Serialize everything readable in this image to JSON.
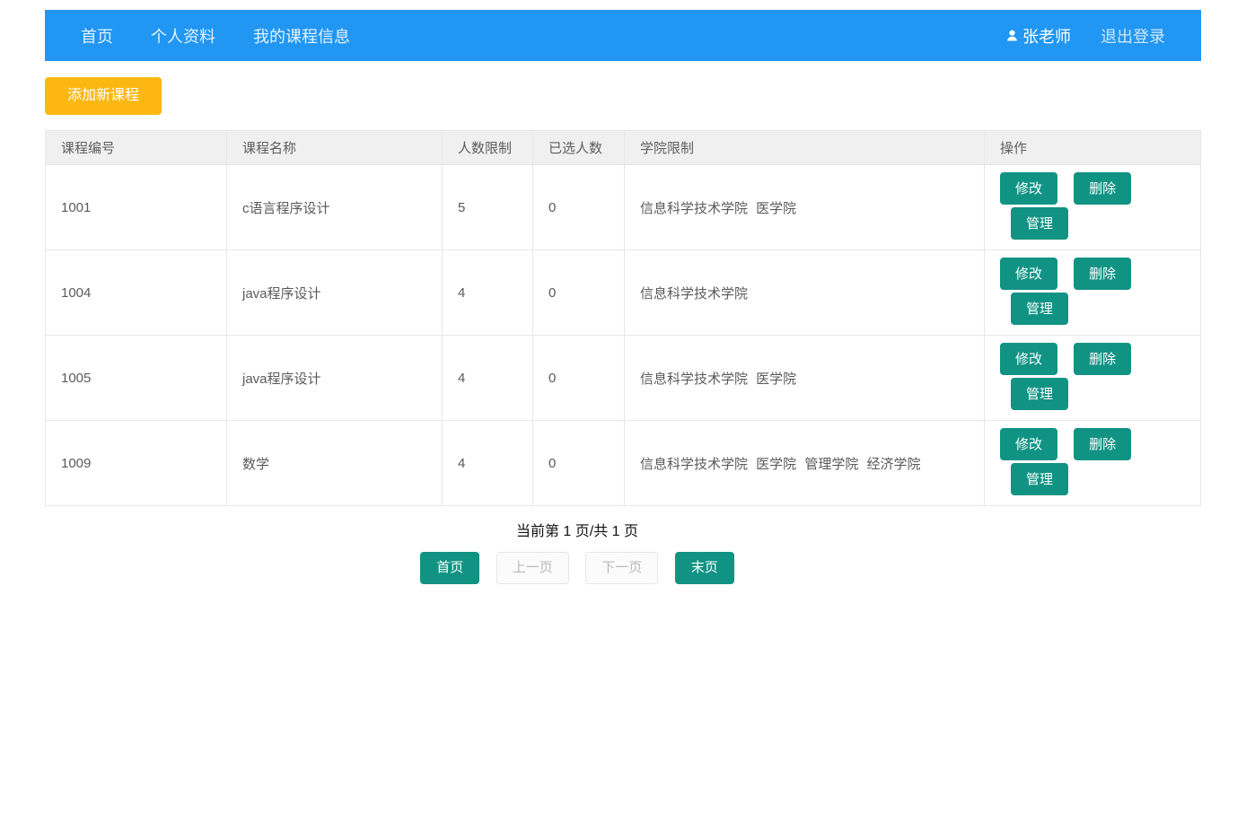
{
  "colors": {
    "navbar": "#2196f3",
    "yellow": "#fcb712",
    "teal": "#119384"
  },
  "navbar": {
    "items": [
      {
        "label": "首页"
      },
      {
        "label": "个人资料"
      },
      {
        "label": "我的课程信息"
      }
    ],
    "user_name": "张老师",
    "logout_label": "退出登录"
  },
  "toolbar": {
    "add_course_label": "添加新课程"
  },
  "table": {
    "headers": [
      "课程编号",
      "课程名称",
      "人数限制",
      "已选人数",
      "学院限制",
      "操作"
    ],
    "actions": {
      "edit": "修改",
      "delete": "删除",
      "manage": "管理"
    },
    "rows": [
      {
        "id": "1001",
        "name": "c语言程序设计",
        "limit": "5",
        "selected": "0",
        "colleges": "信息科学技术学院 医学院"
      },
      {
        "id": "1004",
        "name": "java程序设计",
        "limit": "4",
        "selected": "0",
        "colleges": "信息科学技术学院"
      },
      {
        "id": "1005",
        "name": "java程序设计",
        "limit": "4",
        "selected": "0",
        "colleges": "信息科学技术学院 医学院"
      },
      {
        "id": "1009",
        "name": "数学",
        "limit": "4",
        "selected": "0",
        "colleges": "信息科学技术学院 医学院 管理学院 经济学院"
      }
    ]
  },
  "pagination": {
    "status": "当前第 1 页/共 1 页",
    "first_label": "首页",
    "prev_label": "上一页",
    "next_label": "下一页",
    "last_label": "末页"
  }
}
